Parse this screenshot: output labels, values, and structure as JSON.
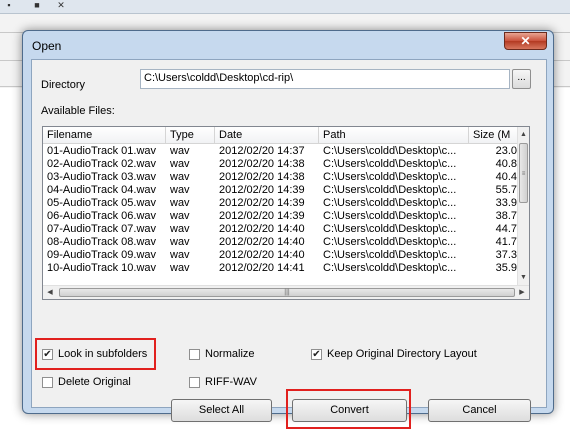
{
  "dialog": {
    "title": "Open",
    "close_glyph": "✕",
    "directory_label": "Directory",
    "directory_value": "C:\\Users\\coldd\\Desktop\\cd-rip\\",
    "browse_label": "...",
    "available_files_label": "Available Files:"
  },
  "files": {
    "columns": [
      "Filename",
      "Type",
      "Date",
      "Path",
      "Size (M"
    ],
    "rows": [
      {
        "filename": "01-AudioTrack 01.wav",
        "type": "wav",
        "date": "2012/02/20 14:37",
        "path": "C:\\Users\\coldd\\Desktop\\c...",
        "size": "23.0"
      },
      {
        "filename": "02-AudioTrack 02.wav",
        "type": "wav",
        "date": "2012/02/20 14:38",
        "path": "C:\\Users\\coldd\\Desktop\\c...",
        "size": "40.8"
      },
      {
        "filename": "03-AudioTrack 03.wav",
        "type": "wav",
        "date": "2012/02/20 14:38",
        "path": "C:\\Users\\coldd\\Desktop\\c...",
        "size": "40.4"
      },
      {
        "filename": "04-AudioTrack 04.wav",
        "type": "wav",
        "date": "2012/02/20 14:39",
        "path": "C:\\Users\\coldd\\Desktop\\c...",
        "size": "55.7"
      },
      {
        "filename": "05-AudioTrack 05.wav",
        "type": "wav",
        "date": "2012/02/20 14:39",
        "path": "C:\\Users\\coldd\\Desktop\\c...",
        "size": "33.9"
      },
      {
        "filename": "06-AudioTrack 06.wav",
        "type": "wav",
        "date": "2012/02/20 14:39",
        "path": "C:\\Users\\coldd\\Desktop\\c...",
        "size": "38.7"
      },
      {
        "filename": "07-AudioTrack 07.wav",
        "type": "wav",
        "date": "2012/02/20 14:40",
        "path": "C:\\Users\\coldd\\Desktop\\c...",
        "size": "44.7"
      },
      {
        "filename": "08-AudioTrack 08.wav",
        "type": "wav",
        "date": "2012/02/20 14:40",
        "path": "C:\\Users\\coldd\\Desktop\\c...",
        "size": "41.7"
      },
      {
        "filename": "09-AudioTrack 09.wav",
        "type": "wav",
        "date": "2012/02/20 14:40",
        "path": "C:\\Users\\coldd\\Desktop\\c...",
        "size": "37.3"
      },
      {
        "filename": "10-AudioTrack 10.wav",
        "type": "wav",
        "date": "2012/02/20 14:41",
        "path": "C:\\Users\\coldd\\Desktop\\c...",
        "size": "35.9"
      }
    ]
  },
  "options": {
    "look_in_subfolders": {
      "label": "Look in subfolders",
      "checked": true
    },
    "normalize": {
      "label": "Normalize",
      "checked": false
    },
    "keep_layout": {
      "label": "Keep Original Directory Layout",
      "checked": true
    },
    "delete_original": {
      "label": "Delete Original",
      "checked": false
    },
    "riff_wav": {
      "label": "RIFF-WAV",
      "checked": false
    }
  },
  "buttons": {
    "select_all": "Select All",
    "convert": "Convert",
    "cancel": "Cancel"
  },
  "colors": {
    "highlight": "#e1201e",
    "dialog_frame": "#c6d9ee",
    "close_button": "#c9503a"
  }
}
